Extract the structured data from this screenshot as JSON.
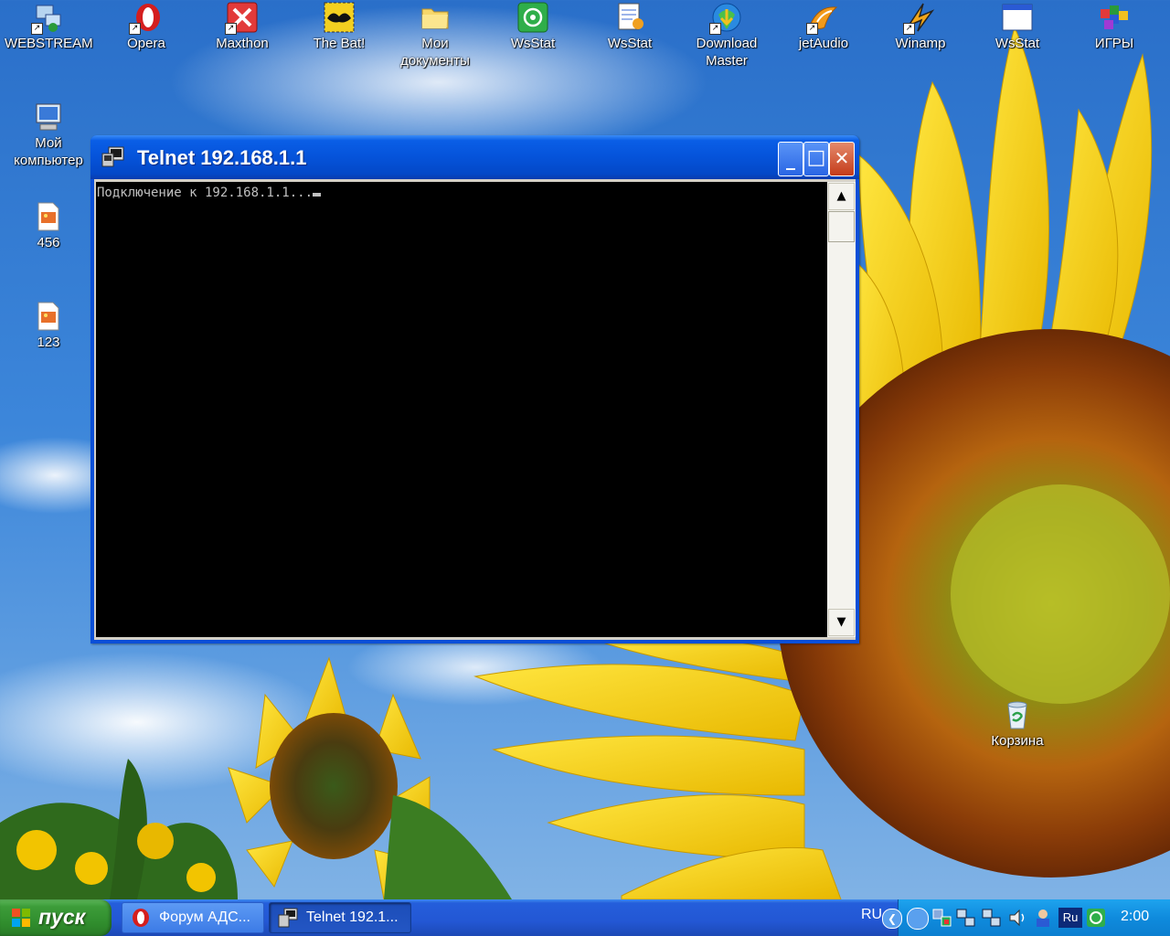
{
  "desktop": {
    "top_icons": [
      {
        "label": "WEBSTREAM",
        "icon": "network-computer-icon"
      },
      {
        "label": "Opera",
        "icon": "opera-icon"
      },
      {
        "label": "Maxthon",
        "icon": "maxthon-icon"
      },
      {
        "label": "The Bat!",
        "icon": "the-bat-icon"
      },
      {
        "label": "Мои документы",
        "icon": "folder-icon"
      },
      {
        "label": "WsStat",
        "icon": "wsstat-green-icon"
      },
      {
        "label": "WsStat",
        "icon": "wsstat-notepad-icon"
      },
      {
        "label": "Download Master",
        "icon": "download-master-icon"
      },
      {
        "label": "jetAudio",
        "icon": "jetaudio-icon"
      },
      {
        "label": "Winamp",
        "icon": "winamp-icon"
      },
      {
        "label": "WsStat",
        "icon": "wsstat-window-icon"
      },
      {
        "label": "ИГРЫ",
        "icon": "games-icon"
      }
    ],
    "left_icons": [
      {
        "label": "Мой компьютер",
        "icon": "my-computer-icon"
      },
      {
        "label": "456",
        "icon": "image-file-icon"
      },
      {
        "label": "123",
        "icon": "image-file-icon"
      }
    ],
    "recycle_bin": {
      "label": "Корзина",
      "icon": "recycle-bin-icon"
    }
  },
  "telnet_window": {
    "title": "Telnet 192.168.1.1",
    "console_text": "Подключение к 192.168.1.1...",
    "buttons": {
      "minimize": "_",
      "maximize": "□",
      "close": "✕"
    }
  },
  "taskbar": {
    "start_label": "пуск",
    "tasks": [
      {
        "label": "Форум АДС...",
        "icon": "opera-icon",
        "active": false
      },
      {
        "label": "Telnet 192.1...",
        "icon": "telnet-icon",
        "active": true
      }
    ],
    "language": "RU",
    "tray_keyboard": "Ru",
    "clock": "2:00"
  },
  "colors": {
    "titlebar": "#0553da",
    "taskbar": "#245edb",
    "start_button": "#3c9c39",
    "tray": "#0f8bdd",
    "console_bg": "#000000",
    "console_text": "#c0c0c0"
  }
}
